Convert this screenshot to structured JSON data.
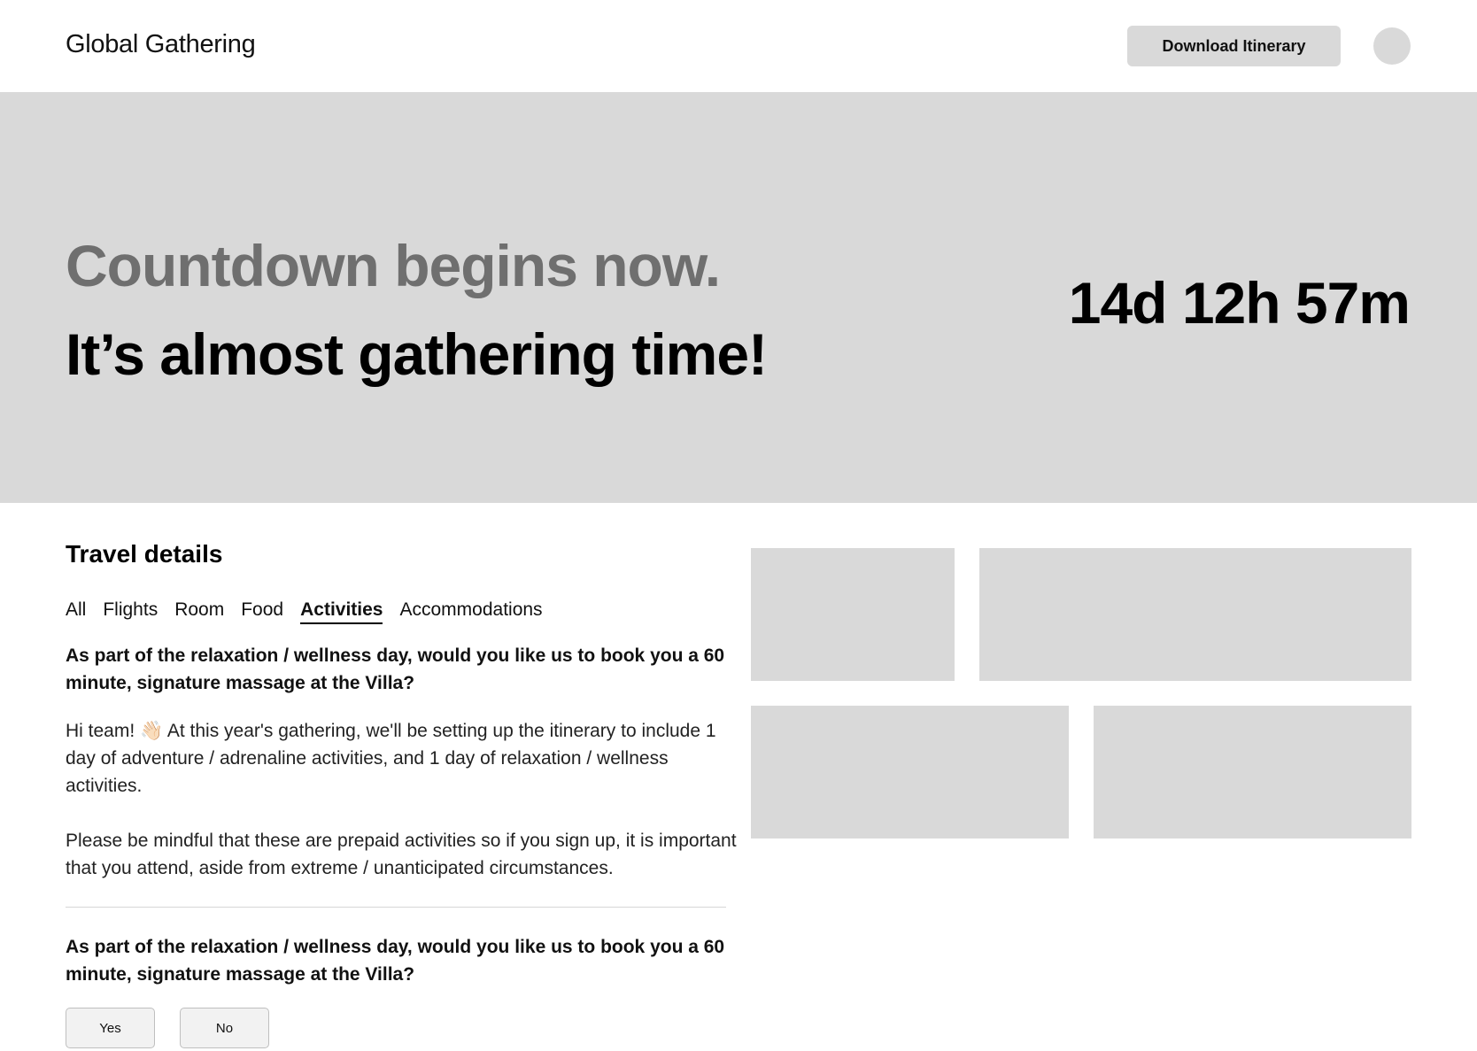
{
  "header": {
    "brand": "Global Gathering",
    "download_label": "Download Itinerary"
  },
  "hero": {
    "subtitle": "Countdown begins now.",
    "title": "It’s almost gathering time!",
    "countdown": "14d 12h 57m"
  },
  "travel": {
    "title": "Travel details",
    "tabs": [
      {
        "label": "All",
        "active": false
      },
      {
        "label": "Flights",
        "active": false
      },
      {
        "label": "Room",
        "active": false
      },
      {
        "label": "Food",
        "active": false
      },
      {
        "label": "Activities",
        "active": true
      },
      {
        "label": "Accommodations",
        "active": false
      }
    ],
    "question_1": "As part of the relaxation / wellness day, would you like us to book you a 60 minute, signature massage at the Villa?",
    "paragraph_1": "Hi team! 👋🏻 At this year's gathering, we'll be setting up the itinerary to include 1 day of adventure / adrenaline activities, and 1 day of relaxation / wellness activities.",
    "paragraph_2": "Please be mindful that these are prepaid activities so if you sign up, it is important that you attend, aside from extreme / unanticipated circumstances.",
    "question_2": "As part of the relaxation / wellness day, would you like us to book you a 60 minute, signature massage at the Villa?",
    "yes_label": "Yes",
    "no_label": "No"
  },
  "colors": {
    "placeholder": "#d9d9d9",
    "muted_heading": "#6f6f6f"
  }
}
